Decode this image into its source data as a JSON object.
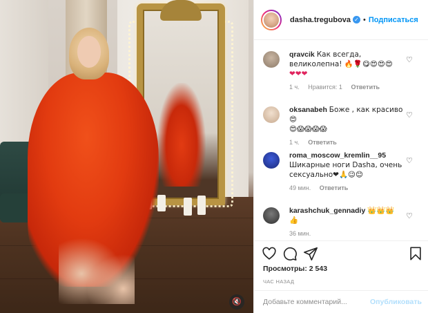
{
  "post": {
    "username": "dasha.tregubova",
    "separator": "•",
    "follow_label": "Подписаться"
  },
  "comments": [
    {
      "user": "qravcik",
      "text": "Как всегда, великолепна! 🔥🌹😋😍😍😍",
      "text2": "❤❤❤",
      "time": "1 ч.",
      "likes": "Нравится: 1",
      "reply": "Ответить"
    },
    {
      "user": "oksanabeh",
      "text": "Боже , как красиво 😍",
      "text2": "😍😱😱😱😱",
      "time": "1 ч.",
      "reply": "Ответить"
    },
    {
      "user": "roma_moscow_kremlin__95",
      "text": "Шикарные ноги Dasha, очень сексуально❤🙏😉😊",
      "time": "49 мин.",
      "reply": "Ответить"
    },
    {
      "user": "karashchuk_gennadiy",
      "text": "👑👑👑",
      "text2": "👍",
      "time": "36 мин."
    }
  ],
  "stats": {
    "views": "Просмотры: 2 543",
    "posted": "ЧАС НАЗАД"
  },
  "composer": {
    "placeholder": "Добавьте комментарий...",
    "publish_label": "Опубликовать"
  },
  "colors": {
    "accent": "#0095f6",
    "publish_disabled": "#b2dffc",
    "dress": "#e23b10"
  },
  "icons": {
    "like": "heart-icon",
    "comment": "comment-icon",
    "share": "share-icon",
    "save": "bookmark-icon",
    "mute": "speaker-muted-icon"
  }
}
